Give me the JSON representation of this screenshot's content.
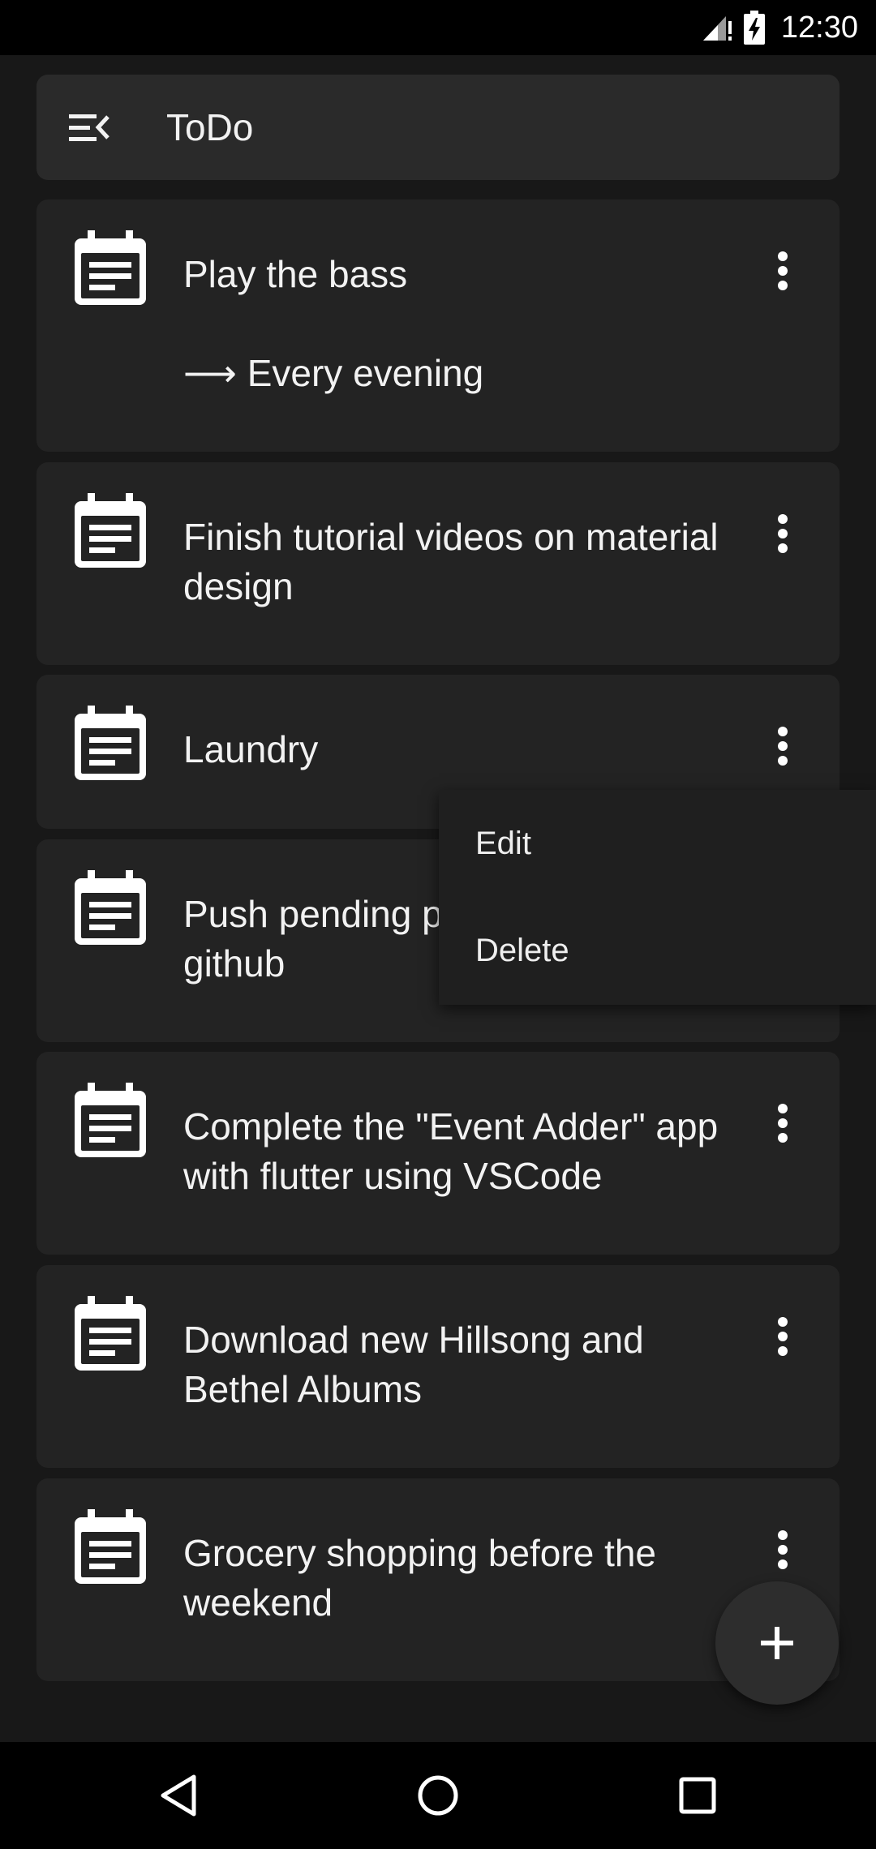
{
  "status_bar": {
    "time": "12:30"
  },
  "app_bar": {
    "title": "ToDo",
    "menu_icon": "menu-open-icon"
  },
  "tasks": [
    {
      "title": "Play the bass",
      "subtitle": "⟶ Every evening"
    },
    {
      "title": "Finish tutorial videos on material design"
    },
    {
      "title": "Laundry"
    },
    {
      "title": "Push pending projects to github",
      "visible_title": "Push pending p",
      "visible_title_line2": "github"
    },
    {
      "title": "Complete the \"Event Adder\" app with flutter using VSCode"
    },
    {
      "title": "Download new Hillsong and Bethel Albums"
    },
    {
      "title": "Grocery shopping before the weekend"
    }
  ],
  "popup_menu": {
    "items": [
      "Edit",
      "Delete"
    ]
  },
  "fab": {
    "icon": "plus-icon"
  },
  "nav_bar": {
    "back_icon": "back-triangle-icon",
    "home_icon": "home-circle-icon",
    "recents_icon": "recents-square-icon"
  },
  "colors": {
    "background": "#181818",
    "card": "#232323",
    "app_bar": "#2a2a2a",
    "text": "#f2f2f2"
  }
}
